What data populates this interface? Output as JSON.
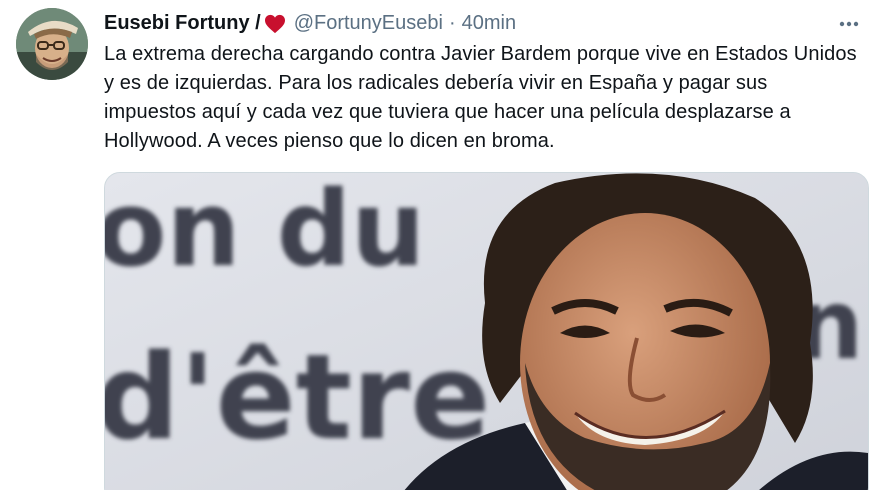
{
  "author": {
    "display_name": "Eusebi Fortuny /",
    "handle": "@FortunyEusebi",
    "separator": "·",
    "time": "40min"
  },
  "tweet": {
    "text": "La extrema derecha cargando contra Javier Bardem porque vive en Estados Unidos y es de izquierdas. Para los radicales debería vivir en España y pagar sus impuestos aquí y cada vez que tuviera que hacer una película desplazarse a Hollywood. A veces pienso que lo dicen en broma."
  },
  "media": {
    "background_text_line1": "on du",
    "background_text_line2": "d'être",
    "background_text_right": "n"
  },
  "colors": {
    "heart": "#e0245e",
    "secondary_text": "#5b7083",
    "primary_text": "#0f1419"
  },
  "icons": {
    "heart": "heart-icon",
    "more": "more-icon"
  }
}
